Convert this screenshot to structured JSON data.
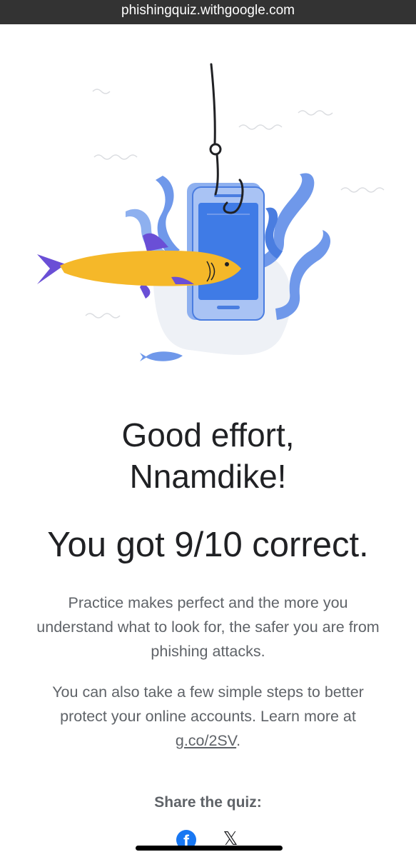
{
  "browser": {
    "url": "phishingquiz.withgoogle.com"
  },
  "result": {
    "headline_line1": "Good effort,",
    "headline_line2": "Nnamdike!",
    "score_text": "You got 9/10 correct.",
    "paragraph1": "Practice makes perfect and the more you understand what to look for, the safer you are from phishing attacks.",
    "paragraph2_text": "You can also take a few simple steps to better protect your online accounts. Learn more at ",
    "paragraph2_link": "g.co/2SV",
    "paragraph2_end": "."
  },
  "share": {
    "label": "Share the quiz:",
    "buttons": [
      {
        "icon": "facebook-icon",
        "glyph": "f"
      },
      {
        "icon": "x-icon",
        "glyph": "𝕏"
      }
    ]
  },
  "colors": {
    "text_dark": "#202124",
    "text_muted": "#5f6368",
    "fish_yellow": "#f5b829",
    "fin_purple": "#6a4fd6",
    "seaweed_blue": "#6f98ea",
    "phone_blue": "#3f7be6"
  }
}
